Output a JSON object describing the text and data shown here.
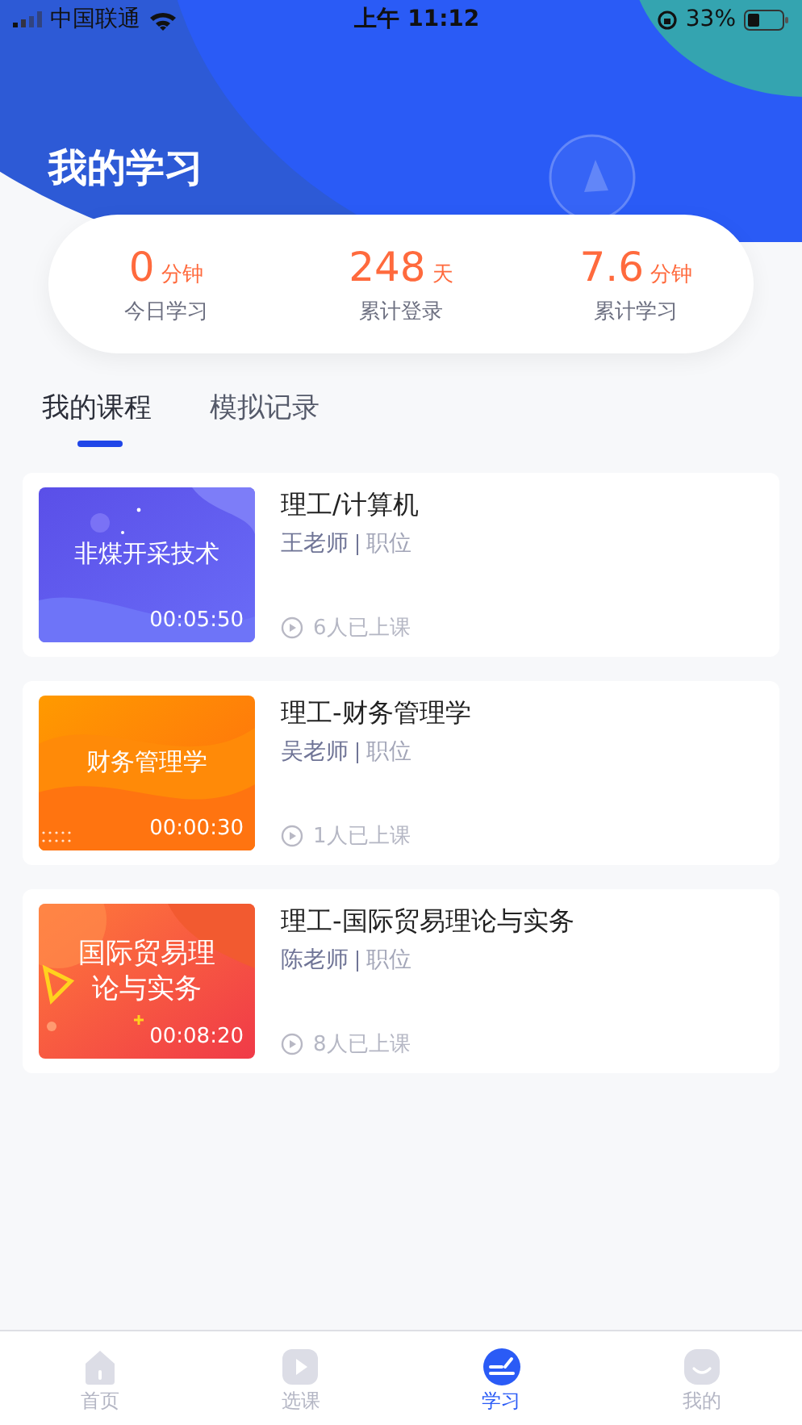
{
  "status_bar": {
    "carrier": "中国联通",
    "time": "上午 11:12",
    "battery": "33%"
  },
  "header": {
    "title": "我的学习"
  },
  "stats": [
    {
      "value": "0",
      "unit": "分钟",
      "label": "今日学习"
    },
    {
      "value": "248",
      "unit": "天",
      "label": "累计登录"
    },
    {
      "value": "7.6",
      "unit": "分钟",
      "label": "累计学习"
    }
  ],
  "tabs": [
    {
      "label": "我的课程",
      "selected": true
    },
    {
      "label": "模拟记录",
      "selected": false
    }
  ],
  "courses": [
    {
      "cover": {
        "kind": "purple",
        "title": "非煤开采技术",
        "duration": "00:05:50"
      },
      "title": "理工/计算机",
      "teacher": "王老师",
      "position": "职位",
      "learners": "6人已上课"
    },
    {
      "cover": {
        "kind": "orange",
        "title": "财务管理学",
        "duration": "00:00:30"
      },
      "title": "理工-财务管理学",
      "teacher": "吴老师",
      "position": "职位",
      "learners": "1人已上课"
    },
    {
      "cover": {
        "kind": "red",
        "title": "国际贸易理论与实务",
        "duration": "00:08:20"
      },
      "title": "理工-国际贸易理论与实务",
      "teacher": "陈老师",
      "position": "职位",
      "learners": "8人已上课"
    }
  ],
  "bottom_nav": [
    {
      "kind": "home",
      "label": "首页",
      "selected": false
    },
    {
      "kind": "play",
      "label": "选课",
      "selected": false
    },
    {
      "kind": "study",
      "label": "学习",
      "selected": true
    },
    {
      "kind": "face",
      "label": "我的",
      "selected": false
    }
  ]
}
